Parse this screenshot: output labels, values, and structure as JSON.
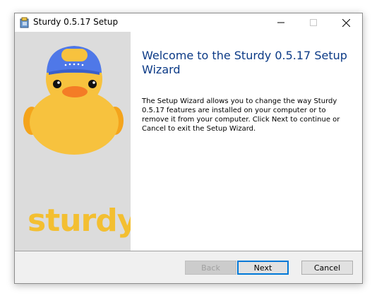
{
  "window": {
    "title": "Sturdy 0.5.17 Setup"
  },
  "sidebar": {
    "brand_text": "sturdy"
  },
  "main": {
    "heading": "Welcome to the Sturdy 0.5.17 Setup Wizard",
    "body": "The Setup Wizard allows you to change the way Sturdy 0.5.17 features are installed on your computer or to remove it from your computer. Click Next to continue or Cancel to exit the Setup Wizard."
  },
  "buttons": {
    "back_label": "Back",
    "next_label": "Next",
    "cancel_label": "Cancel"
  },
  "colors": {
    "brand_yellow": "#f3bf31",
    "heading_blue": "#0b3a86",
    "focus_blue": "#0078d7",
    "cap_blue": "#4f78e8"
  },
  "icons": {
    "app": "installer-icon",
    "mascot": "duck-mascot"
  }
}
